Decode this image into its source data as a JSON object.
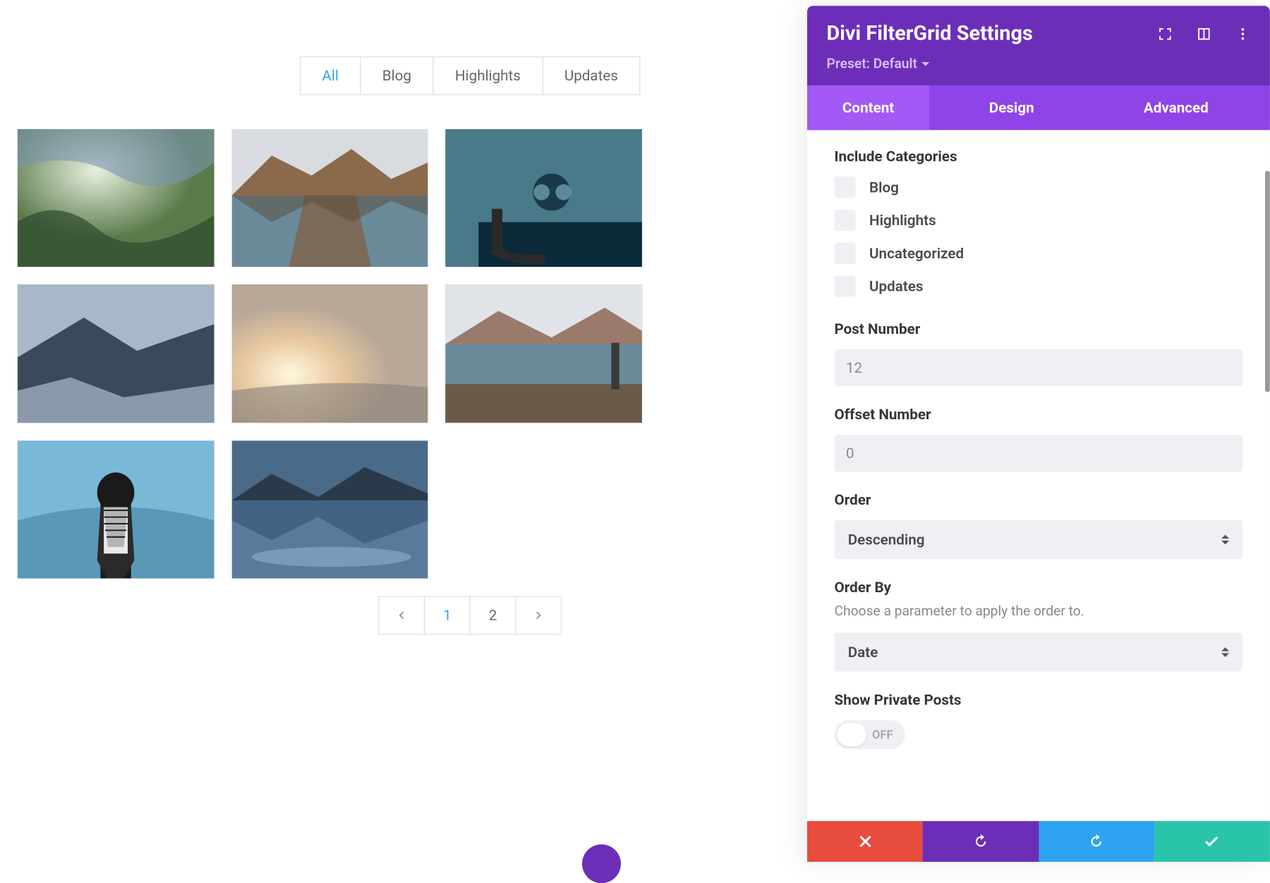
{
  "filters": {
    "items": [
      "All",
      "Blog",
      "Highlights",
      "Updates"
    ],
    "active": 0
  },
  "pagination": {
    "pages": [
      "1",
      "2"
    ],
    "active": 0
  },
  "panel": {
    "title": "Divi FilterGrid Settings",
    "preset": "Preset: Default",
    "tabs": [
      "Content",
      "Design",
      "Advanced"
    ],
    "activeTab": 0,
    "sections": {
      "include_categories": {
        "label": "Include Categories",
        "items": [
          "Blog",
          "Highlights",
          "Uncategorized",
          "Updates"
        ]
      },
      "post_number": {
        "label": "Post Number",
        "value": "12"
      },
      "offset_number": {
        "label": "Offset Number",
        "value": "0"
      },
      "order": {
        "label": "Order",
        "value": "Descending"
      },
      "order_by": {
        "label": "Order By",
        "desc": "Choose a parameter to apply the order to.",
        "value": "Date"
      },
      "show_private": {
        "label": "Show Private Posts",
        "value": "OFF"
      }
    }
  }
}
